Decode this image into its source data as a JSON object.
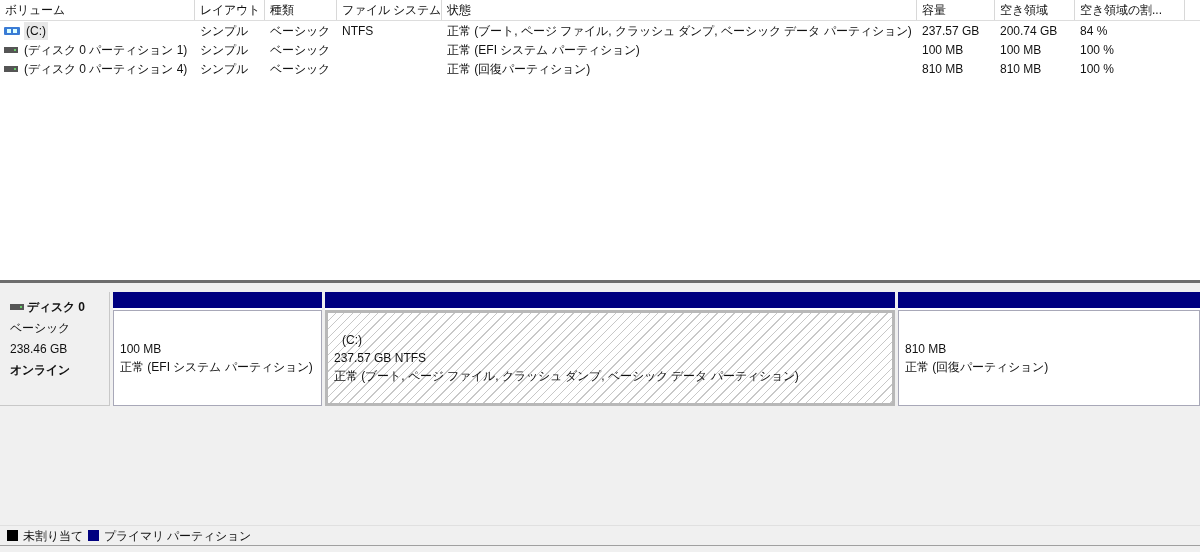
{
  "table": {
    "columns": [
      "ボリューム",
      "レイアウト",
      "種類",
      "ファイル システム",
      "状態",
      "容量",
      "空き領域",
      "空き領域の割..."
    ],
    "rows": [
      {
        "kind": "system",
        "selected": true,
        "cells": [
          "(C:)",
          "シンプル",
          "ベーシック",
          "NTFS",
          "正常 (ブート, ページ ファイル, クラッシュ ダンプ, ベーシック データ パーティション)",
          "237.57 GB",
          "200.74 GB",
          "84 %"
        ]
      },
      {
        "kind": "disk",
        "selected": false,
        "cells": [
          "(ディスク 0 パーティション 1)",
          "シンプル",
          "ベーシック",
          "",
          "正常 (EFI システム パーティション)",
          "100 MB",
          "100 MB",
          "100 %"
        ]
      },
      {
        "kind": "disk",
        "selected": false,
        "cells": [
          "(ディスク 0 パーティション 4)",
          "シンプル",
          "ベーシック",
          "",
          "正常 (回復パーティション)",
          "810 MB",
          "810 MB",
          "100 %"
        ]
      }
    ]
  },
  "disk": {
    "name": "ディスク 0",
    "type": "ベーシック",
    "size": "238.46 GB",
    "status": "オンライン",
    "partitions": [
      {
        "selected": false,
        "color": "#000080",
        "size": "100 MB",
        "status": "正常 (EFI システム パーティション)"
      },
      {
        "selected": true,
        "color": "#000080",
        "label": "(C:)",
        "size": "237.57 GB NTFS",
        "status": "正常 (ブート, ページ ファイル, クラッシュ ダンプ, ベーシック データ パーティション)"
      },
      {
        "selected": false,
        "color": "#000080",
        "size": "810 MB",
        "status": "正常 (回復パーティション)"
      }
    ]
  },
  "legend": [
    {
      "label": "未割り当て",
      "color": "#000000"
    },
    {
      "label": "プライマリ パーティション",
      "color": "#000080"
    }
  ]
}
